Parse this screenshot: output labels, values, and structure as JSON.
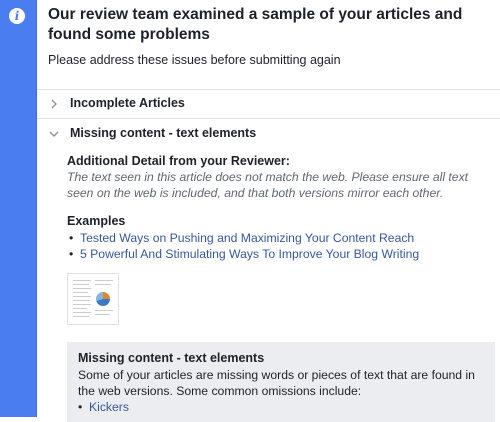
{
  "header": {
    "title": "Our review team examined a sample of your articles and found some problems",
    "subtitle": "Please address these issues before submitting again"
  },
  "sections": [
    {
      "title": "Incomplete Articles",
      "expanded": false,
      "icon": "chevron-right-icon"
    },
    {
      "title": "Missing content - text elements",
      "expanded": true,
      "icon": "chevron-down-icon"
    }
  ],
  "reviewer": {
    "heading": "Additional Detail from your Reviewer:",
    "text": "The text seen in this article does not match the web. Please ensure all text seen on the web is included, and that both versions mirror each other."
  },
  "examples": {
    "heading": "Examples",
    "items": [
      "Tested Ways on Pushing and Maximizing Your Content Reach",
      "5 Powerful And Stimulating Ways To Improve Your Blog Writing"
    ]
  },
  "info_box": {
    "title": "Missing content - text elements",
    "text": "Some of your articles are missing words or pieces of text that are found in the web versions. Some common omissions include:",
    "items": [
      "Kickers"
    ]
  },
  "colors": {
    "accent_bar": "#4a7ef0",
    "link": "#365899",
    "info_box_bg": "#ebedf0"
  }
}
